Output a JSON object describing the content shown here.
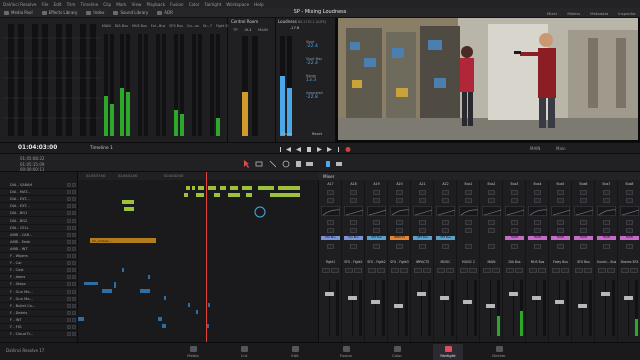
{
  "app": {
    "name": "DaVinci Resolve",
    "version_label": "DaVinci Resolve 17"
  },
  "menu": [
    "DaVinci Resolve",
    "File",
    "Edit",
    "Trim",
    "Timeline",
    "Clip",
    "Mark",
    "View",
    "Playback",
    "Fusion",
    "Color",
    "Fairlight",
    "Workspace",
    "Help"
  ],
  "toolbar": {
    "left": [
      "Media Pool",
      "Effects Library",
      "Index",
      "Sound Library",
      "ADR"
    ],
    "right": [
      "Mixer",
      "Meters",
      "Metadata",
      "Inspector"
    ],
    "project_title": "SP - Mixing Loudness"
  },
  "meters_panel": {
    "channel_labels": [
      "MAIN",
      "DIA Bus",
      "MUS Bus",
      "Fol...Bus",
      "SFX Bus",
      "Gu...us",
      "Dr...7",
      "Fight SFX"
    ]
  },
  "control_room": {
    "title": "Control Room",
    "tp_label": "TP",
    "tp_value": "-9.1",
    "main_label": "MAIN"
  },
  "loudness": {
    "title": "Loudness",
    "standard": "BS.1770-1 (LUFS)",
    "scale_top": "-17.6",
    "readings": [
      {
        "label": "Short",
        "value": "-22.4"
      },
      {
        "label": "Short Max",
        "value": "-22.4"
      },
      {
        "label": "Range",
        "value": "13.3"
      },
      {
        "label": "Integrated",
        "value": "-22.8"
      }
    ],
    "pause_label": "Pause",
    "reset_label": "Reset"
  },
  "viewer": {
    "timecode_label": "MAIN",
    "output_label": "Main"
  },
  "timeline": {
    "timecode": "01:04:03:00",
    "name": "Timeline 1",
    "sub_timecodes": [
      "01:05:08:22",
      "01:05:15:09",
      "00:00:00:11"
    ],
    "ruler_ticks": [
      "01:03:57:00",
      "01:04:01:00",
      "01:04:02:00"
    ],
    "tracks": [
      "DIA - SARAH",
      "DIA - MAT...",
      "DIA - EXT...",
      "DIA - EXT...",
      "DIA - BG1",
      "DIA - BG2",
      "DIA - CELL",
      "AMB - CAR...",
      "AMB - Fade",
      "AMB - INT",
      "F - Wipers",
      "F - Car",
      "F - Cast",
      "F - Jeans",
      "F - Steps",
      "F - Gun Mo...",
      "F - Gun Mo...",
      "F - Bullet Ca...",
      "F - Debris",
      "F - INT",
      "F - FIG",
      "F - Cloud Fi..."
    ],
    "clip_label": "CC_Ambien..."
  },
  "mixer": {
    "title": "Mixer",
    "strips": [
      {
        "input": "A17",
        "bus": "DIA Bus",
        "bus_color": "#7a93d8",
        "name": "Fight1",
        "level": 0.0
      },
      {
        "input": "A18",
        "bus": "DIA Bus",
        "bus_color": "#7a93d8",
        "name": "SFX - Fight1",
        "level": 0.0
      },
      {
        "input": "A19",
        "bus": "SFX Bus",
        "bus_color": "#5aa0c8",
        "name": "SFX - Fight2",
        "level": 0.0
      },
      {
        "input": "A20",
        "bus": "IMPACTS",
        "bus_color": "#e0873a",
        "name": "SFX - Fight3",
        "level": 0.0
      },
      {
        "input": "A21",
        "bus": "SFX Bus",
        "bus_color": "#5aa0c8",
        "name": "IMPACTS",
        "level": 0.0
      },
      {
        "input": "A22",
        "bus": "SFX Bus",
        "bus_color": "#5aa0c8",
        "name": "MUSIC",
        "level": 0.0
      },
      {
        "input": "Bus1",
        "bus": "",
        "bus_color": "",
        "name": "MUSIC 2",
        "level": 0.0
      },
      {
        "input": "Bus2",
        "bus": "",
        "bus_color": "",
        "name": "MAIN",
        "level": 0.35
      },
      {
        "input": "Bus3",
        "bus": "MAIN",
        "bus_color": "#c66bc9",
        "name": "DIA Bus",
        "level": 0.45
      },
      {
        "input": "Bus4",
        "bus": "MAIN",
        "bus_color": "#c66bc9",
        "name": "MUS Bus",
        "level": 0.0
      },
      {
        "input": "Bus5",
        "bus": "MAIN",
        "bus_color": "#c66bc9",
        "name": "Foley Bus",
        "level": 0.0
      },
      {
        "input": "Bus6",
        "bus": "MAIN",
        "bus_color": "#c66bc9",
        "name": "SFX Bus",
        "level": 0.0
      },
      {
        "input": "Bus7",
        "bus": "MAIN",
        "bus_color": "#c66bc9",
        "name": "Gunsh... Bus",
        "level": 0.0
      },
      {
        "input": "Bus8",
        "bus": "MAIN",
        "bus_color": "#c66bc9",
        "name": "Drones SFX",
        "level": 0.3
      }
    ]
  },
  "pages": [
    {
      "label": "Media",
      "active": false
    },
    {
      "label": "Cut",
      "active": false
    },
    {
      "label": "Edit",
      "active": false
    },
    {
      "label": "Fusion",
      "active": false
    },
    {
      "label": "Color",
      "active": false
    },
    {
      "label": "Fairlight",
      "active": true
    },
    {
      "label": "Deliver",
      "active": false
    }
  ]
}
